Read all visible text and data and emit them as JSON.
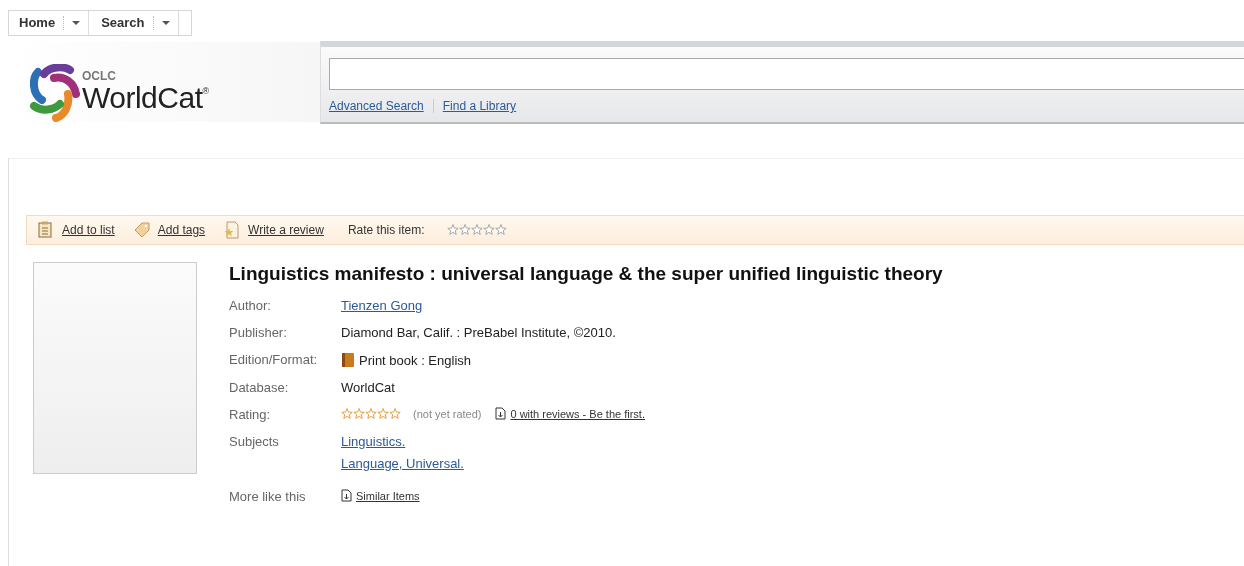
{
  "nav": [
    {
      "label": "Home"
    },
    {
      "label": "Search"
    }
  ],
  "logo": {
    "small": "OCLC",
    "name": "WorldCat",
    "mark": "®"
  },
  "search": {
    "links": [
      "Advanced Search",
      "Find a Library"
    ]
  },
  "toolbar": {
    "actions": [
      {
        "kind": "list",
        "label": "Add to list"
      },
      {
        "kind": "tag",
        "label": "Add tags"
      },
      {
        "kind": "review",
        "label": "Write a review"
      }
    ],
    "rate_label": "Rate this item:",
    "stars": 0
  },
  "record": {
    "title": "Linguistics manifesto : universal language & the super unified linguistic theory",
    "fields": [
      {
        "kind": "link",
        "label": "Author:",
        "values": [
          "Tienzen Gong"
        ]
      },
      {
        "kind": "text",
        "label": "Publisher:",
        "values": [
          "Diamond Bar, Calif. : PreBabel Institute, ©2010."
        ]
      },
      {
        "kind": "format",
        "label": "Edition/Format:",
        "values": [
          "Print book : English"
        ]
      },
      {
        "kind": "text",
        "label": "Database:",
        "values": [
          "WorldCat"
        ]
      },
      {
        "kind": "rating",
        "label": "Rating:",
        "stars": 0,
        "note": "(not yet rated)",
        "link": "0 with reviews - Be the first."
      },
      {
        "kind": "link",
        "label": "Subjects",
        "values": [
          "Linguistics.",
          "Language, Universal."
        ]
      },
      {
        "kind": "doclink",
        "label": "More like this",
        "values": [
          "Similar Items"
        ]
      }
    ]
  }
}
